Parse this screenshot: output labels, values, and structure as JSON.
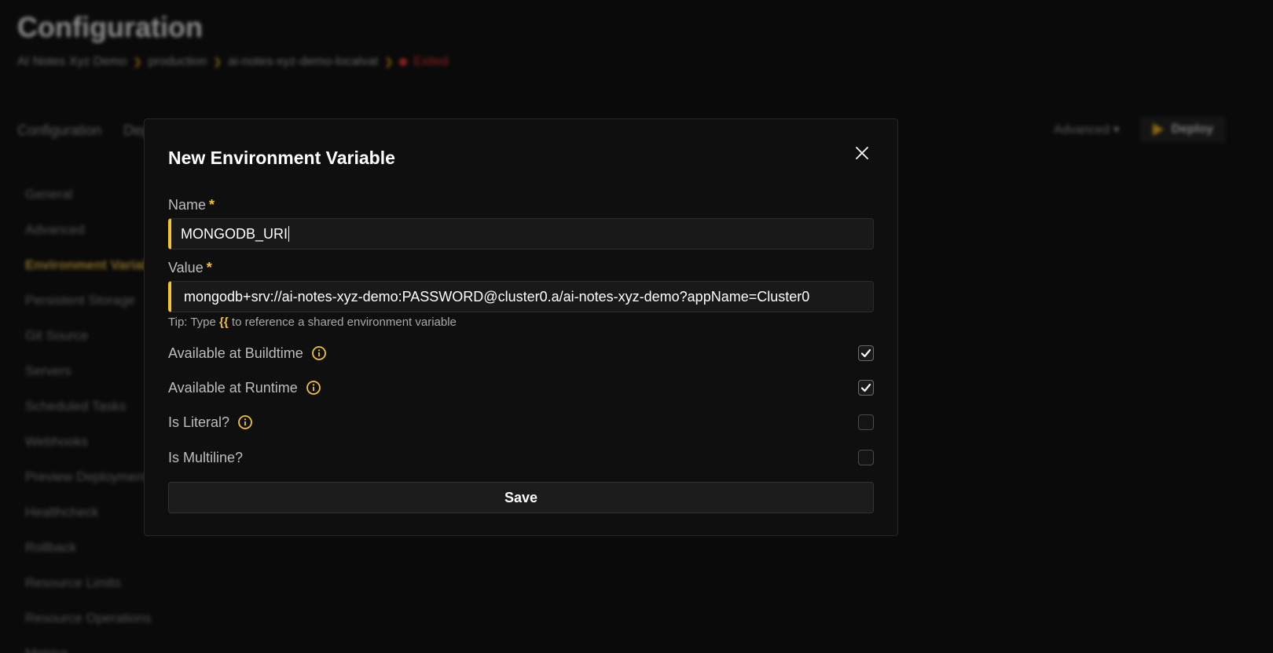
{
  "background": {
    "title": "Configuration",
    "breadcrumbs": [
      "AI Notes Xyz Demo",
      "production",
      "ai-notes-xyz-demo-localvat"
    ],
    "status": "Exited",
    "tabs": [
      "Configuration",
      "Deployments"
    ],
    "advanced_label": "Advanced",
    "deploy_label": "Deploy",
    "sidebar_items": [
      "General",
      "Advanced",
      "Environment Variables",
      "Persistent Storage",
      "Git Source",
      "Servers",
      "Scheduled Tasks",
      "Webhooks",
      "Preview Deployments",
      "Healthcheck",
      "Rollback",
      "Resource Limits",
      "Resource Operations",
      "Metrics"
    ],
    "active_sidebar_item": "Environment Variables"
  },
  "modal": {
    "title": "New Environment Variable",
    "name_label": "Name",
    "name_value": "MONGODB_URI",
    "value_label": "Value",
    "value_value": "mongodb+srv://ai-notes-xyz-demo:PASSWORD@cluster0.a/ai-notes-xyz-demo?appName=Cluster0",
    "required_mark": "*",
    "tip_prefix": "Tip: Type",
    "tip_brace": "{{",
    "tip_suffix": "to reference a shared environment variable",
    "options": [
      {
        "label": "Available at Buildtime",
        "info": true,
        "checked": true
      },
      {
        "label": "Available at Runtime",
        "info": true,
        "checked": true
      },
      {
        "label": "Is Literal?",
        "info": true,
        "checked": false
      },
      {
        "label": "Is Multiline?",
        "info": false,
        "checked": false
      }
    ],
    "save_label": "Save"
  },
  "colors": {
    "accent": "#f2c230",
    "background": "#101010",
    "modal_bg": "#0f0f0f",
    "status_red": "#e03030"
  }
}
